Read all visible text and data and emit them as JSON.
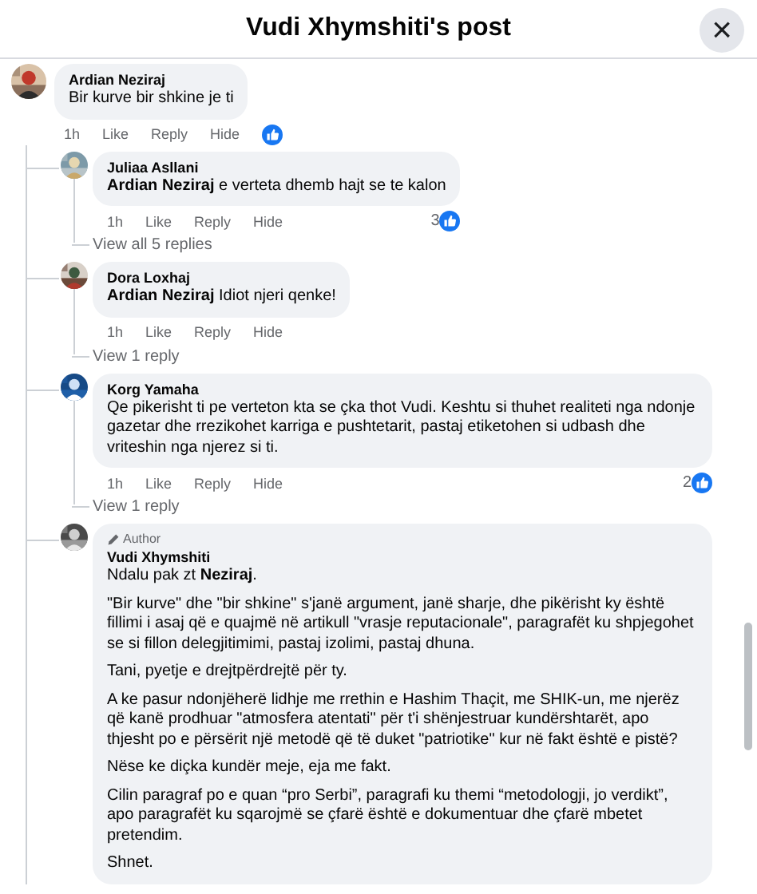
{
  "header": {
    "title": "Vudi Xhymshiti's post",
    "close": "×"
  },
  "comment": {
    "author": "Ardian Neziraj",
    "text": "Bir kurve bir shkine je ti",
    "actions": [
      "1h",
      "Like",
      "Reply",
      "Hide"
    ],
    "reacted": true
  },
  "replies": [
    {
      "author": "Juliaa Asllani",
      "paragraphs": [
        "**Ardian Neziraj** e verteta dhemb hajt se te kalon"
      ],
      "actions": [
        "1h",
        "Like",
        "Reply",
        "Hide"
      ],
      "reaction_count": "3",
      "view_more": "View all 5 replies"
    },
    {
      "author": "Dora Loxhaj",
      "paragraphs": [
        "**Ardian Neziraj** Idiot njeri qenke!"
      ],
      "actions": [
        "1h",
        "Like",
        "Reply",
        "Hide"
      ],
      "view_more": "View 1 reply"
    },
    {
      "author": "Korg Yamaha",
      "paragraphs": [
        "Qe pikerisht ti pe verteton kta se çka thot Vudi. Keshtu si thuhet realiteti nga ndonje gazetar dhe rrezikohet karriga e pushtetarit, pastaj etiketohen si udbash dhe vriteshin nga njerez si ti."
      ],
      "actions": [
        "1h",
        "Like",
        "Reply",
        "Hide"
      ],
      "reaction_count": "2",
      "view_more": "View 1 reply"
    },
    {
      "author": "Vudi Xhymshiti",
      "badge": "Author",
      "paragraphs": [
        "Ndalu pak zt **Neziraj**.",
        "\"Bir kurve\" dhe \"bir shkine\" s'janë argument, janë sharje, dhe pikërisht ky është fillimi i asaj që e quajmë në artikull \"vrasje reputacionale\", paragrafët ku shpjegohet se si fillon delegjitimimi, pastaj izolimi, pastaj dhuna.",
        "Tani, pyetje e drejtpërdrejtë për ty.",
        "A ke pasur ndonjëherë lidhje me rrethin e Hashim Thaçit, me SHIK-un, me njerëz që kanë prodhuar \"atmosfera atentati\" për t'i shënjestruar kundërshtarët, apo thjesht po e përsërit një metodë që të duket \"patriotike\" kur në fakt është e pistë?",
        "Nëse ke diçka kundër meje, eja me fakt.",
        "Cilin paragraf po e quan “pro Serbi”, paragrafi ku themi “metodologji, jo verdikt”, apo paragrafët ku sqarojmë se çfarë është e dokumentuar dhe çfarë mbetet pretendim.",
        "Shnet."
      ]
    }
  ]
}
